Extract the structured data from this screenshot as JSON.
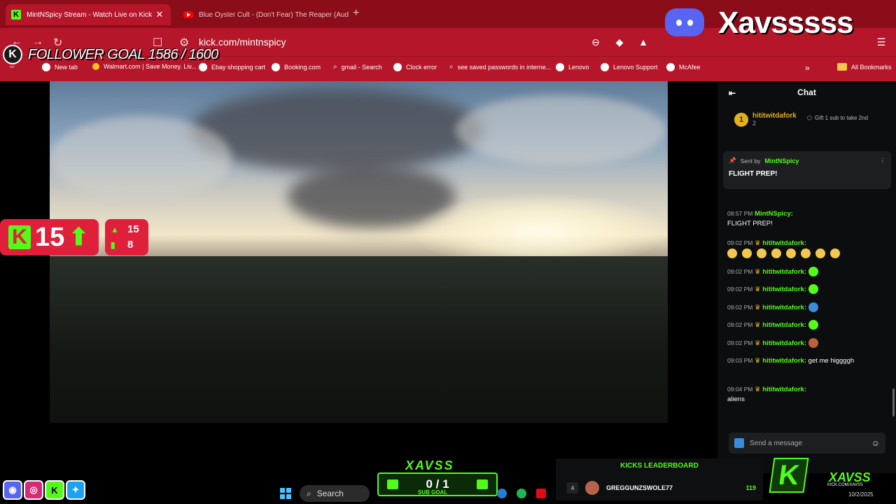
{
  "browser": {
    "tabs": [
      {
        "title": "MintNSpicy Stream - Watch Live on Kick",
        "close": "✕"
      },
      {
        "title": "Blue Oyster Cult - (Don't Fear) The Reaper (Audio)"
      }
    ],
    "new_tab": "+",
    "url": "kick.com/mintnspicy",
    "bookmarks": [
      "New tab",
      "Walmart.com | Save Money. Liv...",
      "Ebay shopping cart",
      "Booking.com",
      "gmail - Search",
      "Clock error",
      "see saved passwords in interne...",
      "Lenovo",
      "Lenovo Support",
      "McAfee"
    ],
    "more_bookmarks": "»",
    "all_bookmarks": "All Bookmarks"
  },
  "overlay": {
    "follower_goal": "FOLLOWER GOAL 1586 / 1600",
    "kick_count": "15",
    "stat_followers": "15",
    "stat_viewers": "8",
    "brand": "Xavsssss",
    "sub_goal_brand": "XAVSS",
    "sub_goal_count": "0 / 1",
    "sub_goal_label": "SUB GOAL",
    "kicks_leaderboard_title": "KICKS LEADERBOARD",
    "kicks_rank": "4",
    "kicks_user": "GREGGUNZSWOLE77",
    "kicks_amount": "119",
    "logo_text": "XAVSS",
    "logo_sub": "KICK.COM/XAVSS"
  },
  "chat": {
    "title": "Chat",
    "leader": {
      "rank": "1",
      "user": "hititwitdafork",
      "subs": "2"
    },
    "gift_note": "Gift 1 sub to take 2nd",
    "pinned": {
      "sent_by": "Sent by",
      "user": "MintNSpicy",
      "text": "FLIGHT PREP!"
    },
    "messages": [
      {
        "time": "08:57 PM",
        "user": "MintNSpicy:",
        "text": "FLIGHT PREP!"
      },
      {
        "time": "09:02 PM",
        "user": "hititwitdafork:",
        "text": ""
      },
      {
        "time": "09:02 PM",
        "user": "hititwitdafork:",
        "text": ""
      },
      {
        "time": "09:02 PM",
        "user": "hititwitdafork:",
        "text": ""
      },
      {
        "time": "09:02 PM",
        "user": "hititwitdafork:",
        "text": ""
      },
      {
        "time": "09:02 PM",
        "user": "hititwitdafork:",
        "text": ""
      },
      {
        "time": "09:02 PM",
        "user": "hititwitdafork:",
        "text": ""
      },
      {
        "time": "09:03 PM",
        "user": "hititwitdafork:",
        "text": "get me higgggh"
      },
      {
        "time": "09:04 PM",
        "user": "hititwitdafork:",
        "text": "aliens"
      }
    ],
    "input_placeholder": "Send a message"
  },
  "taskbar": {
    "search": "Search",
    "date": "10/2/2025"
  }
}
